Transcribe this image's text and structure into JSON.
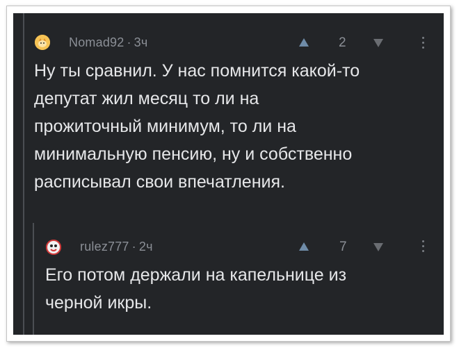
{
  "comments": [
    {
      "author": "Nomad92",
      "separator": "·",
      "time": "3ч",
      "score": "2",
      "avatar_color": "#f3b23a",
      "upvote_icon": "triangle-up",
      "downvote_icon": "triangle-down",
      "more_icon": "vertical-dots",
      "text": "Ну ты сравнил. У нас помнится какой-то\nдепутат жил месяц то ли на\nпрожиточный минимум, то ли на\nминимальную пенсию, ну и собственно\nрасписывал свои впечатления."
    },
    {
      "author": "rulez777",
      "separator": "·",
      "time": "2ч",
      "score": "7",
      "avatar_color": "#d23b3b",
      "upvote_icon": "triangle-up",
      "downvote_icon": "triangle-down",
      "more_icon": "vertical-dots",
      "text": "Его потом держали на капельнице из\nчерной икры."
    }
  ],
  "colors": {
    "background": "#232528",
    "text": "#e6e7e9",
    "meta": "#8b8f96",
    "upvote": "#6f8ca8",
    "thread_line": "#4b4e53"
  }
}
